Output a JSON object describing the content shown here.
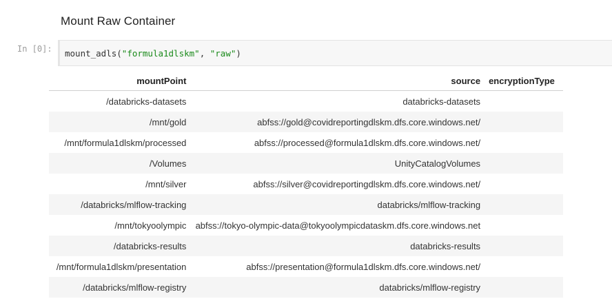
{
  "markdown_cell": {
    "heading": "Mount Raw Container"
  },
  "code_cell": {
    "prompt": "In [0]:",
    "code": {
      "fn": "mount_adls(",
      "arg1": "\"formula1dlskm\"",
      "sep": ", ",
      "arg2": "\"raw\"",
      "close": ")"
    }
  },
  "output_table": {
    "columns": [
      "mountPoint",
      "source",
      "encryptionType"
    ],
    "rows": [
      {
        "mountPoint": "/databricks-datasets",
        "source": "databricks-datasets",
        "encryptionType": ""
      },
      {
        "mountPoint": "/mnt/gold",
        "source": "abfss://gold@covidreportingdlskm.dfs.core.windows.net/",
        "encryptionType": ""
      },
      {
        "mountPoint": "/mnt/formula1dlskm/processed",
        "source": "abfss://processed@formula1dlskm.dfs.core.windows.net/",
        "encryptionType": ""
      },
      {
        "mountPoint": "/Volumes",
        "source": "UnityCatalogVolumes",
        "encryptionType": ""
      },
      {
        "mountPoint": "/mnt/silver",
        "source": "abfss://silver@covidreportingdlskm.dfs.core.windows.net/",
        "encryptionType": ""
      },
      {
        "mountPoint": "/databricks/mlflow-tracking",
        "source": "databricks/mlflow-tracking",
        "encryptionType": ""
      },
      {
        "mountPoint": "/mnt/tokyoolympic",
        "source": "abfss://tokyo-olympic-data@tokyoolympicdataskm.dfs.core.windows.net",
        "encryptionType": ""
      },
      {
        "mountPoint": "/databricks-results",
        "source": "databricks-results",
        "encryptionType": ""
      },
      {
        "mountPoint": "/mnt/formula1dlskm/presentation",
        "source": "abfss://presentation@formula1dlskm.dfs.core.windows.net/",
        "encryptionType": ""
      },
      {
        "mountPoint": "/databricks/mlflow-registry",
        "source": "databricks/mlflow-registry",
        "encryptionType": ""
      }
    ]
  },
  "colors": {
    "string_literal": "#1a8a1a",
    "row_stripe": "#f5f5f5",
    "code_background": "#f7f7f7"
  }
}
